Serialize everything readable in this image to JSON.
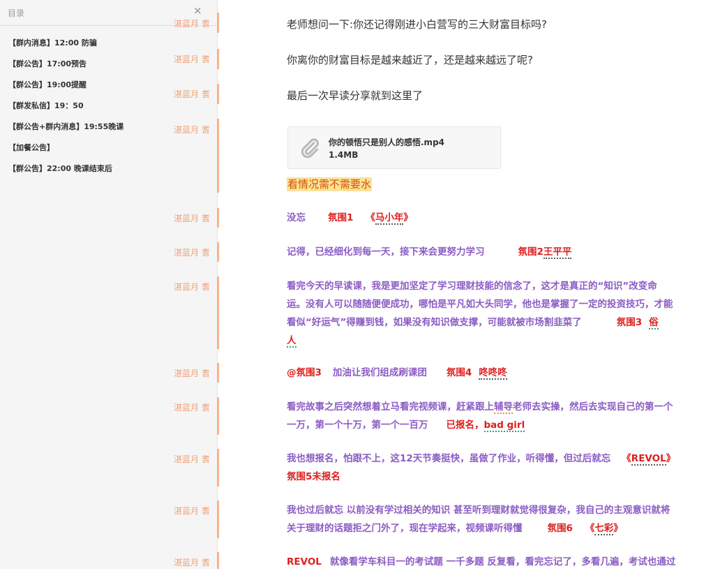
{
  "toc": {
    "title": "目录",
    "close_glyph": "×",
    "items": [
      "【群内消息】12:00 防骗",
      "【群公告】17:00预告",
      "【群公告】19:00提醒",
      "【群发私信】19：50",
      "【群公告+群内消息】19:55晚课",
      "【加餐公告】",
      "【群公告】22:00 晚课结束后"
    ]
  },
  "author": "湛蓝月 耆",
  "messages": {
    "m1": "老师想问一下:你还记得刚进小白营写的三大财富目标吗?",
    "m2": "你离你的财富目标是越来越近了，还是越来越远了呢?",
    "m3": "最后一次早读分享就到这里了",
    "file": {
      "name": "你的顿悟只是别人的感悟.mp4",
      "size": "1.4MB",
      "icon": "paperclip-icon"
    },
    "highlight": "看情况需不需要水",
    "r1": {
      "a": "没忘",
      "b": "氛围1",
      "c": "《",
      "d": "马小年",
      "e": "》"
    },
    "r2": {
      "a": "记得，已经细化到每一天，接下来会更努力学习",
      "b": "氛围2",
      "c": "王平平"
    },
    "r3": {
      "l1": "看完今天的早读课，我是更加坚定了学习理财技能的信念了，这才是真正的“知识”改变命",
      "l2": "运。没有人可以随随便便成功，哪怕是平凡如大头同学，他也是掌握了一定的投资技巧，才能",
      "l3": "看似“好运气”得赚到钱，如果没有知识做支撑，可能就被市场割韭菜了",
      "tag": "氛围3",
      "n1": "俗",
      "n2": "人"
    },
    "r4": {
      "a": "@氛围3",
      "b": "加油让我们组成刷课团",
      "c": "氛围4",
      "d": "咚咚咚"
    },
    "r5": {
      "l1a": "看完故事之后突然想着立马看完视频课，赶紧跟上",
      "l1b": "辅导",
      "l1c": "老师去实操，然后去实现自己的第一个",
      "l2a": "一万，第一个十万，第一个一百万",
      "l2b": "已报名，",
      "l2c": "bad girl"
    },
    "r6": {
      "l1a": "我也想报名，怕跟不上，这12天节奏挺快，虽做了作业，听得懂，但过后就忘",
      "l1b": "《",
      "l1c": "REVOL",
      "l1d": "》",
      "l2": "氛围5未报名"
    },
    "r7": {
      "l1": "我也过后就忘 以前没有学过相关的知识 甚至听到理财就觉得很复杂，我自己的主观意识就将",
      "l2a": "关于理财的话题拒之门外了，现在学起来，视频课听得懂",
      "l2b": "氛围6",
      "l2c": "《",
      "l2d": "七彩",
      "l2e": "》"
    },
    "r8": {
      "a": "REVOL",
      "b": "就像看学车科目一的考试题 一千多题 反复看，看完忘记了，多看几遍，考试也通过"
    }
  }
}
